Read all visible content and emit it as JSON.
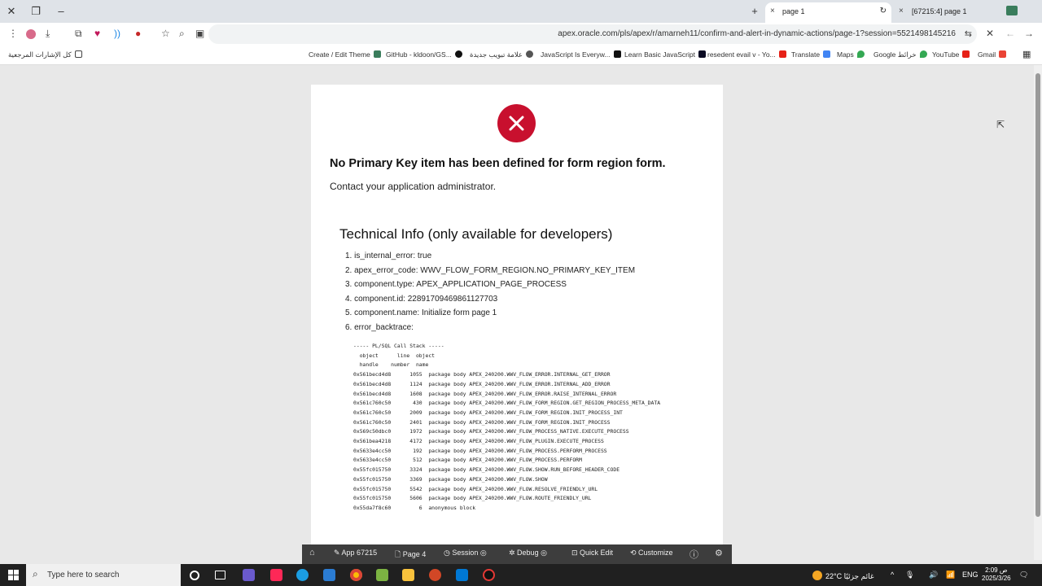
{
  "browser": {
    "tabs": [
      {
        "label": "page 1",
        "close": "×"
      },
      {
        "label": "[67215:4] page 1",
        "close": "×"
      }
    ],
    "new_tab": "+",
    "address": "apex.oracle.com/pls/apex/r/amarneh11/confirm-and-alert-in-dynamic-actions/page-1?session=5521498145216",
    "bookmarks": [
      {
        "label": "كل الإشارات المرجعية",
        "color": "#444444"
      },
      {
        "label": "Create / Edit Theme",
        "color": "#3a7d5c"
      },
      {
        "label": "GitHub - kldoon/GS...",
        "color": "#111111"
      },
      {
        "label": "علامة تبويب جديدة",
        "color": "#555555"
      },
      {
        "label": "JavaScript Is Everyw...",
        "color": "#111111"
      },
      {
        "label": "Learn Basic JavaScript",
        "color": "#0a0a23"
      },
      {
        "label": "resedent evail v - Yo...",
        "color": "#e62117"
      },
      {
        "label": "Translate",
        "color": "#4285f4"
      },
      {
        "label": "Maps",
        "color": "#34a853"
      },
      {
        "label": "Google خرائط",
        "color": "#34a853"
      },
      {
        "label": "YouTube",
        "color": "#e62117"
      },
      {
        "label": "Gmail",
        "color": "#ea4335"
      }
    ]
  },
  "error": {
    "title": "No Primary Key item has been defined for form region form.",
    "subtitle": "Contact your application administrator.",
    "tech_title": "Technical Info (only available for developers)",
    "items": [
      "1. is_internal_error: true",
      "2. apex_error_code: WWV_FLOW_FORM_REGION.NO_PRIMARY_KEY_ITEM",
      "3. component.type: APEX_APPLICATION_PAGE_PROCESS",
      "4. component.id: 22891709469861127703",
      "5. component.name: Initialize form page 1",
      "6. error_backtrace:"
    ],
    "stack_lines": [
      "----- PL/SQL Call Stack -----",
      "  object      line  object",
      "  handle    number  name",
      "0x561becd4d8      1055  package body APEX_240200.WWV_FLOW_ERROR.INTERNAL_GET_ERROR",
      "0x561becd4d8      1124  package body APEX_240200.WWV_FLOW_ERROR.INTERNAL_ADD_ERROR",
      "0x561becd4d8      1608  package body APEX_240200.WWV_FLOW_ERROR.RAISE_INTERNAL_ERROR",
      "0x561c760c50       430  package body APEX_240200.WWV_FLOW_FORM_REGION.GET_REGION_PROCESS_META_DATA",
      "0x561c760c50      2009  package body APEX_240200.WWV_FLOW_FORM_REGION.INIT_PROCESS_INT",
      "0x561c760c50      2401  package body APEX_240200.WWV_FLOW_FORM_REGION.INIT_PROCESS",
      "0x569c50dbc0      1972  package body APEX_240200.WWV_FLOW_PROCESS_NATIVE.EXECUTE_PROCESS",
      "0x561bea4218      4172  package body APEX_240200.WWV_FLOW_PLUGIN.EXECUTE_PROCESS",
      "0x5633e4cc50       192  package body APEX_240200.WWV_FLOW_PROCESS.PERFORM_PROCESS",
      "0x5633e4cc50       512  package body APEX_240200.WWV_FLOW_PROCESS.PERFORM",
      "0x55fc015750      3324  package body APEX_240200.WWV_FLOW.SHOW.RUN_BEFORE_HEADER_CODE",
      "0x55fc015750      3369  package body APEX_240200.WWV_FLOW.SHOW",
      "0x55fc015750      5542  package body APEX_240200.WWV_FLOW.RESOLVE_FRIENDLY_URL",
      "0x55fc015750      5606  package body APEX_240200.WWV_FLOW.ROUTE_FRIENDLY_URL",
      "0x55da7f8c60         6  anonymous block"
    ]
  },
  "devbar": {
    "app": "App 67215",
    "page": "Page 4",
    "session": "Session",
    "debug": "Debug",
    "quick_edit": "Quick Edit",
    "customize": "Customize"
  },
  "taskbar": {
    "search_placeholder": "Type here to search",
    "weather": "22°C  غائم جزئيًا",
    "lang": "ENG",
    "time": "2:09 ص",
    "date": "2025/3/26"
  },
  "colors": {
    "error_red": "#c8102e",
    "devbar_bg": "#3d3d3d",
    "taskbar_bg": "#202020"
  }
}
